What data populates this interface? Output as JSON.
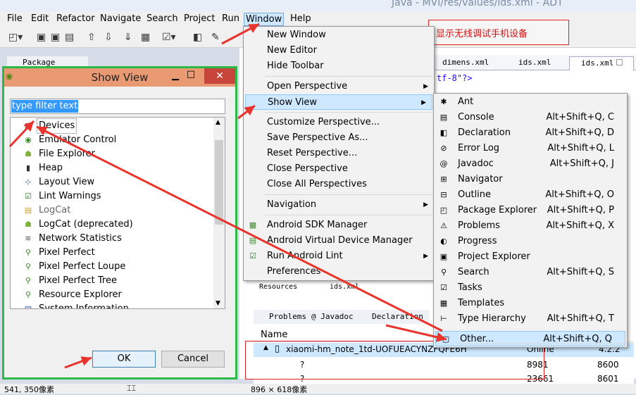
{
  "window_title": "Java - MVI/res/values/ids.xml - ADT",
  "menubar": [
    "File",
    "Edit",
    "Refactor",
    "Navigate",
    "Search",
    "Project",
    "Run",
    "Window",
    "Help"
  ],
  "annotation": "显示无线调试手机设备",
  "editor_tabs": [
    "dimens.xml",
    "ids.xml",
    "ids.xml"
  ],
  "editor_snippet": "tf-8\"?>",
  "package_explorer_tab": "Package Explorer",
  "window_menu": {
    "items": [
      {
        "label": "New Window"
      },
      {
        "label": "New Editor"
      },
      {
        "label": "Hide Toolbar"
      },
      {
        "label": "Open Perspective"
      },
      {
        "label": "Show View"
      },
      {
        "label": "Customize Perspective..."
      },
      {
        "label": "Save Perspective As..."
      },
      {
        "label": "Reset Perspective..."
      },
      {
        "label": "Close Perspective"
      },
      {
        "label": "Close All Perspectives"
      },
      {
        "label": "Navigation"
      },
      {
        "label": "Android SDK Manager"
      },
      {
        "label": "Android Virtual Device Manager"
      },
      {
        "label": "Run Android Lint"
      },
      {
        "label": "Preferences"
      }
    ]
  },
  "show_view_menu": {
    "items": [
      {
        "label": "Ant",
        "shortcut": ""
      },
      {
        "label": "Console",
        "shortcut": "Alt+Shift+Q, C"
      },
      {
        "label": "Declaration",
        "shortcut": "Alt+Shift+Q, D"
      },
      {
        "label": "Error Log",
        "shortcut": "Alt+Shift+Q, L"
      },
      {
        "label": "Javadoc",
        "shortcut": "Alt+Shift+Q, J"
      },
      {
        "label": "Navigator",
        "shortcut": ""
      },
      {
        "label": "Outline",
        "shortcut": "Alt+Shift+Q, O"
      },
      {
        "label": "Package Explorer",
        "shortcut": "Alt+Shift+Q, P"
      },
      {
        "label": "Problems",
        "shortcut": "Alt+Shift+Q, X"
      },
      {
        "label": "Progress",
        "shortcut": ""
      },
      {
        "label": "Project Explorer",
        "shortcut": ""
      },
      {
        "label": "Search",
        "shortcut": "Alt+Shift+Q, S"
      },
      {
        "label": "Tasks",
        "shortcut": ""
      },
      {
        "label": "Templates",
        "shortcut": ""
      },
      {
        "label": "Type Hierarchy",
        "shortcut": "Alt+Shift+Q, T"
      },
      {
        "label": "Other...",
        "shortcut": "Alt+Shift+Q, Q"
      }
    ]
  },
  "dialog": {
    "title": "Show View",
    "filter_placeholder": "type filter text",
    "items": [
      "Devices",
      "Emulator Control",
      "File Explorer",
      "Heap",
      "Layout View",
      "Lint Warnings",
      "LogCat",
      "LogCat (deprecated)",
      "Network Statistics",
      "Pixel Perfect",
      "Pixel Perfect Loupe",
      "Pixel Perfect Tree",
      "Resource Explorer",
      "System Information"
    ],
    "ok": "OK",
    "cancel": "Cancel"
  },
  "lower_tabs": {
    "resources": "Resources",
    "ids": "ids.xml"
  },
  "problems_tabs": [
    "Problems",
    "@ Javadoc",
    "Declaration"
  ],
  "devices_table": {
    "header": "Name",
    "device": "xiaomi-hm_note_1td-UOFUEACYNZFQFE6H",
    "status": "Online",
    "version": "4.2.2",
    "rows": [
      {
        "name": "?",
        "pid": "8981",
        "port": "8600"
      },
      {
        "name": "?",
        "pid": "23661",
        "port": "8601"
      }
    ]
  },
  "status": {
    "left": "541, 350像素",
    "right": "896 × 618像素"
  }
}
